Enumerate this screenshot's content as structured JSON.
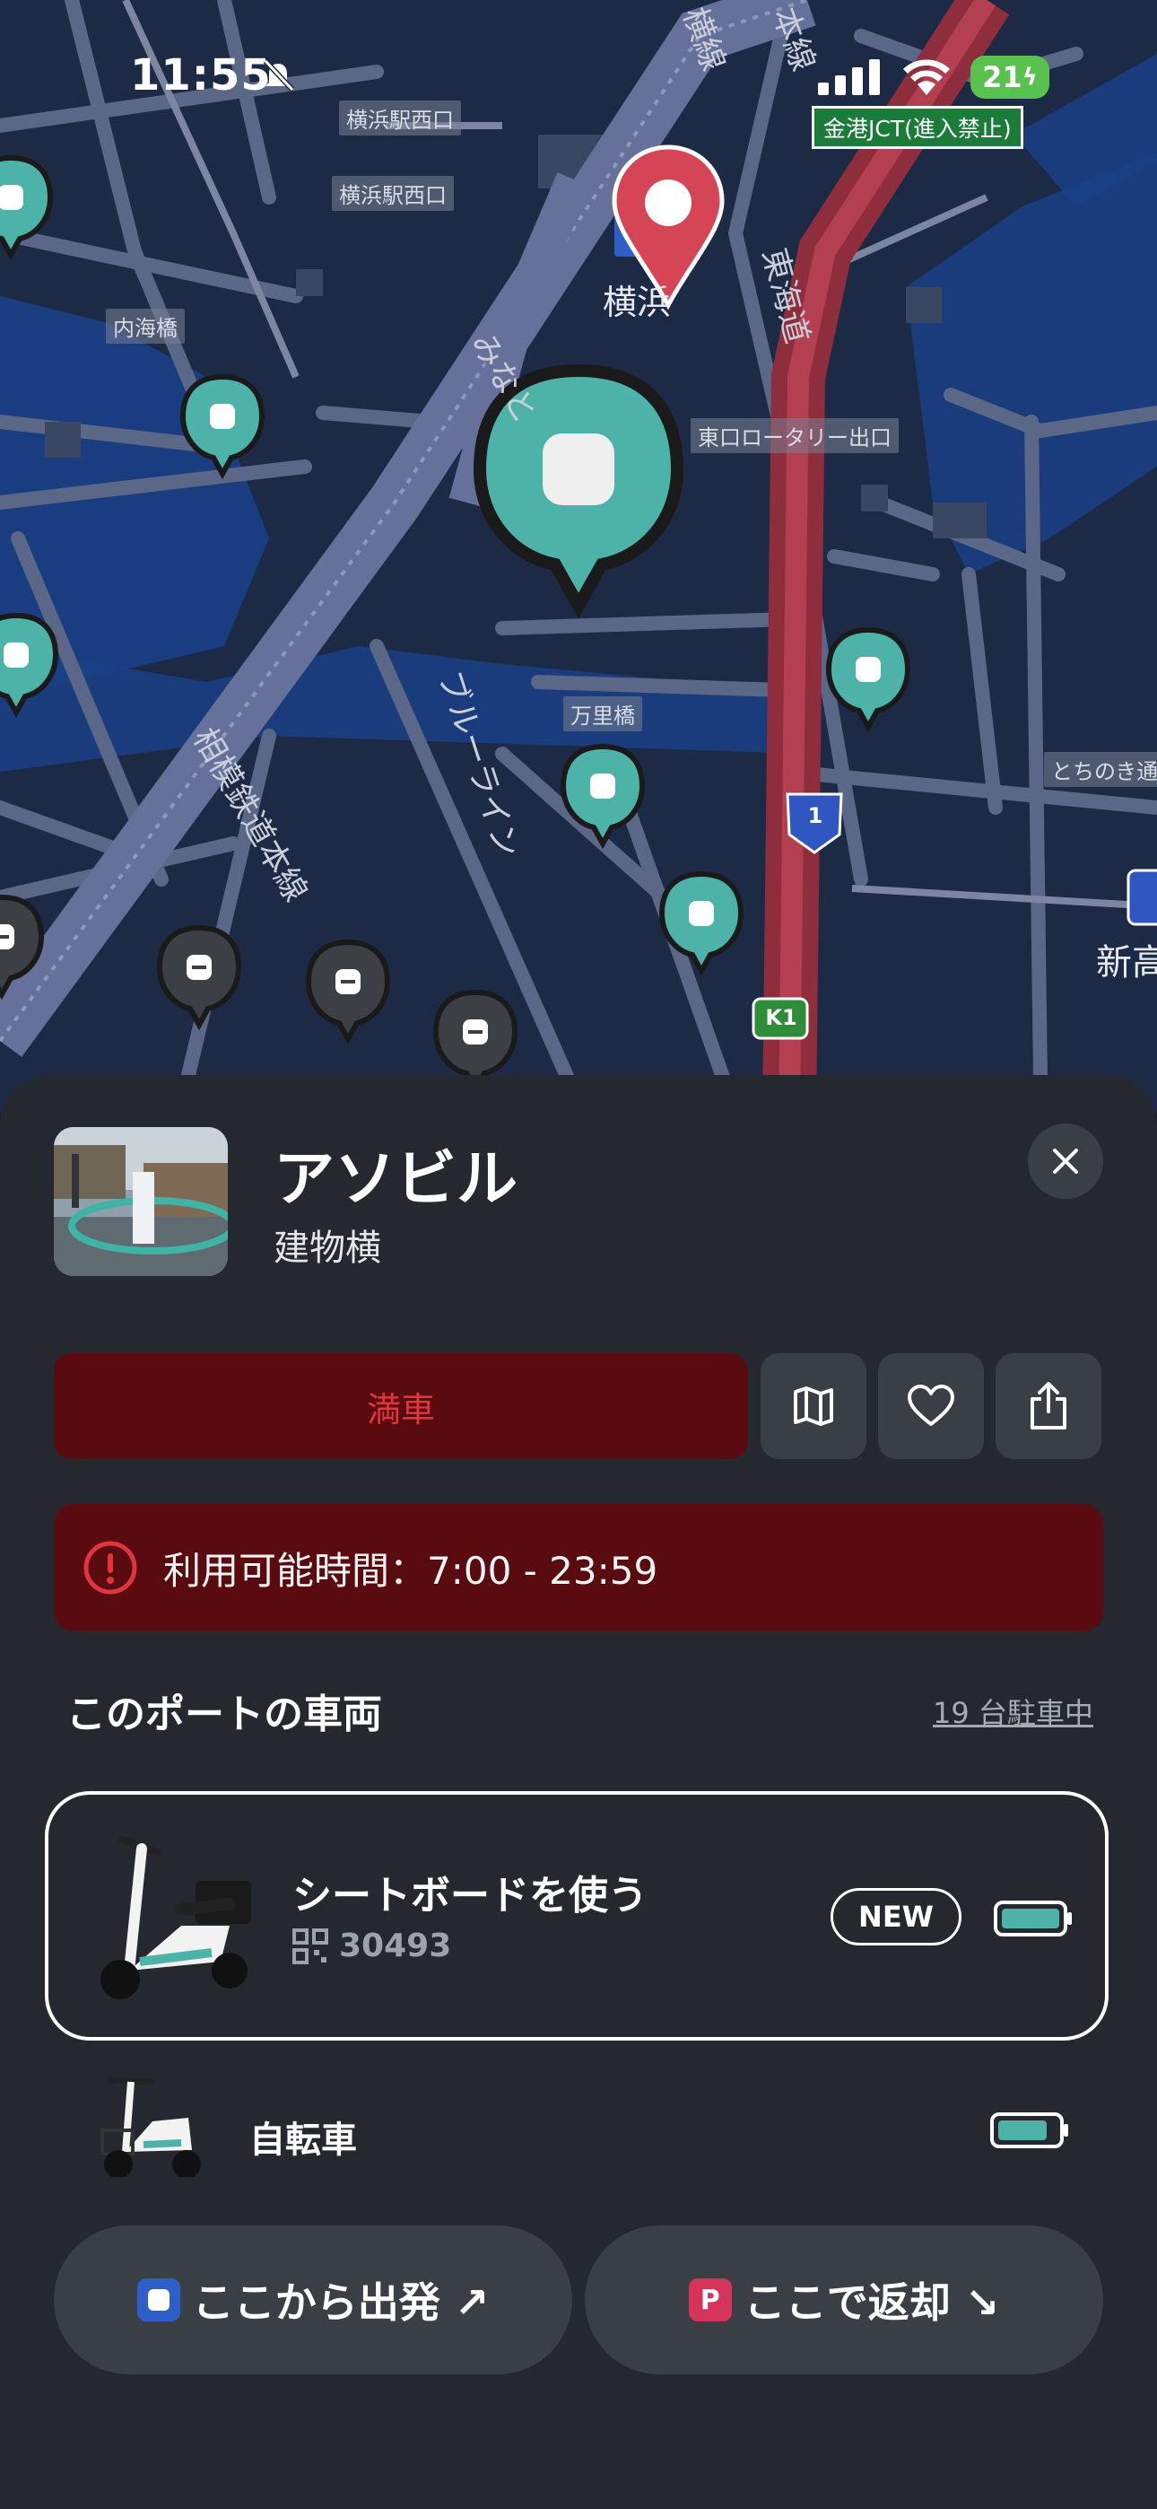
{
  "status_bar": {
    "time": "11:55",
    "battery": "21"
  },
  "map": {
    "jct_sign": "金港JCT(進入禁止)",
    "labels": {
      "yokohama_west_exit_1": "横浜駅西口",
      "yokohama_west_exit_2": "横浜駅西口",
      "uchikaibashi": "内海橋",
      "east_rotary_exit": "東口ロータリー出口",
      "banribashi": "万里橋",
      "tochinoki": "とちのき通",
      "yokohama": "横浜",
      "shintakashima": "新高",
      "tokaido": "東海道",
      "blueline": "ブルーライン",
      "sotetsu_line": "相模鉄道本線",
      "minato": "みなと",
      "yokohama_line": "横線",
      "honmoku": "本線"
    },
    "route_shields": {
      "route_1": "1",
      "k1": "K1"
    }
  },
  "port": {
    "name": "アソビル",
    "location": "建物横",
    "full_label": "満車",
    "hours_text": "利用可能時間：7:00 - 23:59"
  },
  "vehicles_section": {
    "title": "このポートの車両",
    "count_label": "19 台駐車中"
  },
  "vehicles": [
    {
      "name": "シートボードを使う",
      "id": "30493",
      "badge": "NEW"
    },
    {
      "name": "自転車"
    }
  ],
  "actions": {
    "depart_label": "ここから出発 ↗",
    "return_label": "ここで返却 ↘",
    "return_badge": "P"
  },
  "colors": {
    "accent": "#4db3a8",
    "danger_bg": "#5a0b10",
    "danger_text": "#e0353f",
    "map_bg": "#1d2a45"
  }
}
